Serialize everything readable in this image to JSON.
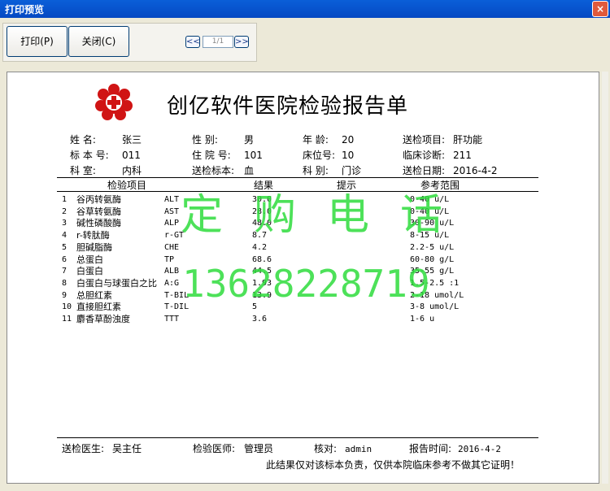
{
  "window": {
    "title": "打印预览",
    "close_glyph": "×"
  },
  "toolbar": {
    "print_label": "打印(P)",
    "close_label": "关闭(C)"
  },
  "pager": {
    "first_glyph": "<<",
    "next_glyph": ">>",
    "page_value": "1/1"
  },
  "report": {
    "title": "创亿软件医院检验报告单",
    "fields": [
      {
        "label": "姓      名:",
        "value": "张三"
      },
      {
        "label": "性      别:",
        "value": "男"
      },
      {
        "label": "年   龄:",
        "value": "20"
      },
      {
        "label": "送检项目:",
        "value": "肝功能"
      },
      {
        "label": "标 本 号:",
        "value": "011"
      },
      {
        "label": "住 院 号:",
        "value": "101"
      },
      {
        "label": "床位号:",
        "value": "10"
      },
      {
        "label": "临床诊断:",
        "value": "211"
      },
      {
        "label": "科      室:",
        "value": "内科"
      },
      {
        "label": "送检标本:",
        "value": "血"
      },
      {
        "label": "科    别:",
        "value": "门诊"
      },
      {
        "label": "送检日期:",
        "value": "2016-4-2"
      }
    ],
    "columns": [
      "检验项目",
      "结果",
      "提示",
      "参考范围"
    ],
    "rows": [
      {
        "no": "1",
        "name": "谷丙转氨酶",
        "code": "ALT",
        "result": "30.0",
        "range": "0-40 u/L"
      },
      {
        "no": "2",
        "name": "谷草转氨酶",
        "code": "AST",
        "result": "28.0",
        "range": "0-40 u/L"
      },
      {
        "no": "3",
        "name": "碱性磷酸酶",
        "code": "ALP",
        "result": "48.0",
        "range": "30-90 u/L"
      },
      {
        "no": "4",
        "name": "r-转肽酶",
        "code": "r-GT",
        "result": "8.7",
        "range": "8-15 u/L"
      },
      {
        "no": "5",
        "name": "胆碱脂酶",
        "code": "CHE",
        "result": "4.2",
        "range": "2.2-5 u/L"
      },
      {
        "no": "6",
        "name": "总蛋白",
        "code": "TP",
        "result": "68.6",
        "range": "60-80 g/L"
      },
      {
        "no": "7",
        "name": "白蛋白",
        "code": "ALB",
        "result": "44.5",
        "range": "35-55 g/L"
      },
      {
        "no": "8",
        "name": "白蛋白与球蛋白之比",
        "code": "A:G",
        "result": "1.93",
        "range": "1.5-2.5 :1"
      },
      {
        "no": "9",
        "name": "总胆红素",
        "code": "T-BIL",
        "result": "13.9",
        "range": "2-18 umol/L"
      },
      {
        "no": "10",
        "name": "直接胆红素",
        "code": "T-DIL",
        "result": "5",
        "range": "3-8 umol/L"
      },
      {
        "no": "11",
        "name": "麝香草酚浊度",
        "code": "TTT",
        "result": "3.6",
        "range": "1-6 u"
      }
    ],
    "footer": {
      "doctor_label": "送检医生:",
      "doctor": "吴主任",
      "tester_label": "检验医师:",
      "tester": "管理员",
      "checker_label": "核对:",
      "checker": "admin",
      "time_label": "报告时间:",
      "time": "2016-4-2",
      "note": "此结果仅对该标本负责，仅供本院临床参考不做其它证明！"
    }
  },
  "watermark": {
    "line1": "定购电话",
    "line2": "13628228719"
  },
  "colors": {
    "titlebar": "#0a5fd8",
    "watermark": "#2edc3d",
    "logo": "#d01414"
  }
}
